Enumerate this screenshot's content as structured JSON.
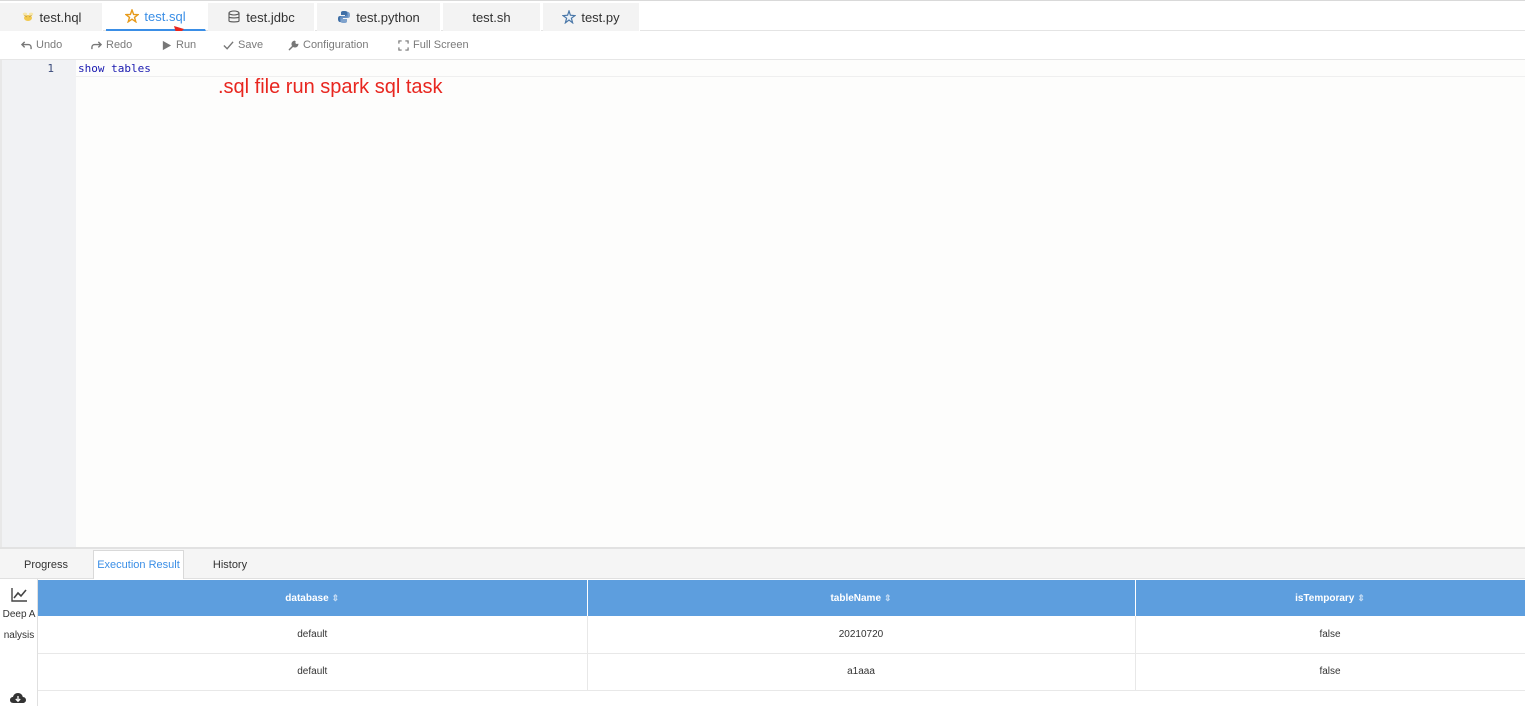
{
  "file_tabs": [
    {
      "label": "test.hql",
      "icon": "hive-bee-icon"
    },
    {
      "label": "test.sql",
      "icon": "spark-star-icon",
      "active": true
    },
    {
      "label": "test.jdbc",
      "icon": "database-icon"
    },
    {
      "label": "test.python",
      "icon": "python-icon"
    },
    {
      "label": "test.sh",
      "icon": ""
    },
    {
      "label": "test.py",
      "icon": "pyspark-icon"
    }
  ],
  "toolbar": {
    "undo": "Undo",
    "redo": "Redo",
    "run": "Run",
    "save": "Save",
    "configuration": "Configuration",
    "full_screen": "Full Screen"
  },
  "editor": {
    "line_number": "1",
    "code": "show tables"
  },
  "annotation": {
    "text": ".sql file run spark sql task",
    "color": "#e8261f"
  },
  "result_tabs": [
    {
      "label": "Progress"
    },
    {
      "label": "Execution Result",
      "active": true
    },
    {
      "label": "History"
    }
  ],
  "side_panel": {
    "deep_analysis": "Deep Analysis"
  },
  "table": {
    "headers": [
      "database",
      "tableName",
      "isTemporary"
    ],
    "rows": [
      [
        "default",
        "20210720",
        "false"
      ],
      [
        "default",
        "a1aaa",
        "false"
      ]
    ]
  },
  "colors": {
    "accent": "#3a8ee6",
    "table_header": "#5d9ede",
    "annotation_red": "#e8261f"
  }
}
